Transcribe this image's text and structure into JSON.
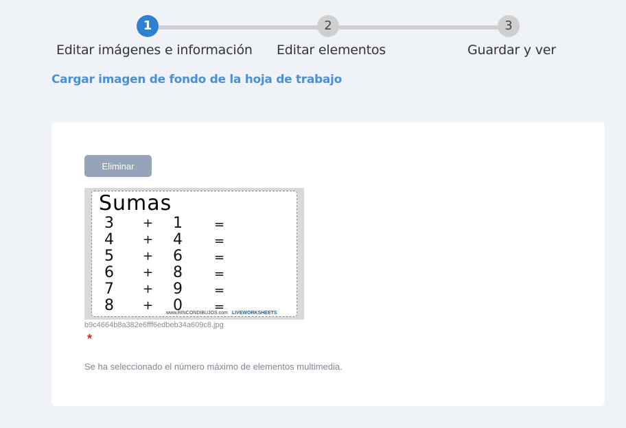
{
  "stepper": {
    "steps": [
      {
        "number": "1",
        "label": "Editar imágenes e información",
        "active": true
      },
      {
        "number": "2",
        "label": "Editar elementos",
        "active": false
      },
      {
        "number": "3",
        "label": "Guardar y ver",
        "active": false
      }
    ]
  },
  "section": {
    "title": "Cargar imagen de fondo de la hoja de trabajo"
  },
  "card": {
    "delete_label": "Eliminar",
    "image": {
      "title": "Sumas",
      "rows": [
        {
          "a": "3",
          "op": "+",
          "b": "1",
          "eq": "="
        },
        {
          "a": "4",
          "op": "+",
          "b": "4",
          "eq": "="
        },
        {
          "a": "5",
          "op": "+",
          "b": "6",
          "eq": "="
        },
        {
          "a": "6",
          "op": "+",
          "b": "8",
          "eq": "="
        },
        {
          "a": "7",
          "op": "+",
          "b": "9",
          "eq": "="
        },
        {
          "a": "8",
          "op": "+",
          "b": "0",
          "eq": "="
        }
      ],
      "footer_site": "www.RINCONDIBUJOS.com",
      "footer_brand": "LIVEWORKSHEETS"
    },
    "filename": "b9c4664b8a382e6fff6edbeb34a609c8.jpg",
    "required_mark": "*",
    "note": "Se ha seleccionado el número máximo de elementos multimedia."
  },
  "colors": {
    "accent": "#2f7fd3",
    "title_link": "#4a90d2",
    "button_bg": "#97a3b8",
    "required": "#e02020",
    "page_bg": "#eff3f8"
  }
}
